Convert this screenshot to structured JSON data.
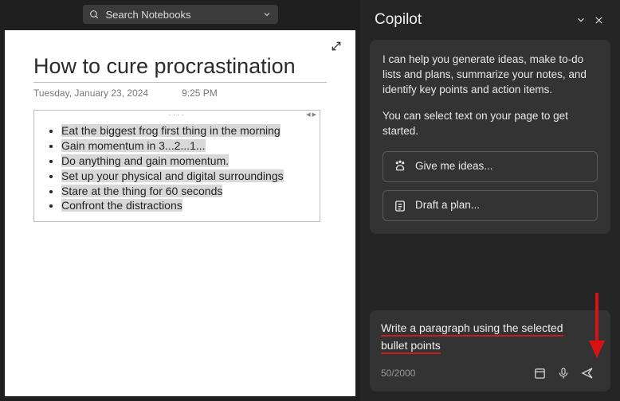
{
  "search": {
    "placeholder": "Search Notebooks"
  },
  "note": {
    "title": "How to cure procrastination",
    "date": "Tuesday, January 23, 2024",
    "time": "9:25 PM",
    "bullets": [
      "Eat the biggest frog first thing in the morning",
      "Gain momentum in 3...2...1...",
      "Do anything and gain momentum.",
      "Set up your physical and digital surroundings",
      "Stare at the thing for 60 seconds",
      "Confront the distractions"
    ]
  },
  "copilot": {
    "title": "Copilot",
    "intro": "I can help you generate ideas, make to-do lists and plans, summarize your notes, and identify key points and action items.",
    "hint": "You can select text on your page to get started.",
    "suggestions": {
      "ideas": "Give me ideas...",
      "plan": "Draft a plan..."
    },
    "prompt_part1": "Write a paragraph using the selected",
    "prompt_part2": "bullet points",
    "char_count": "50/2000"
  }
}
